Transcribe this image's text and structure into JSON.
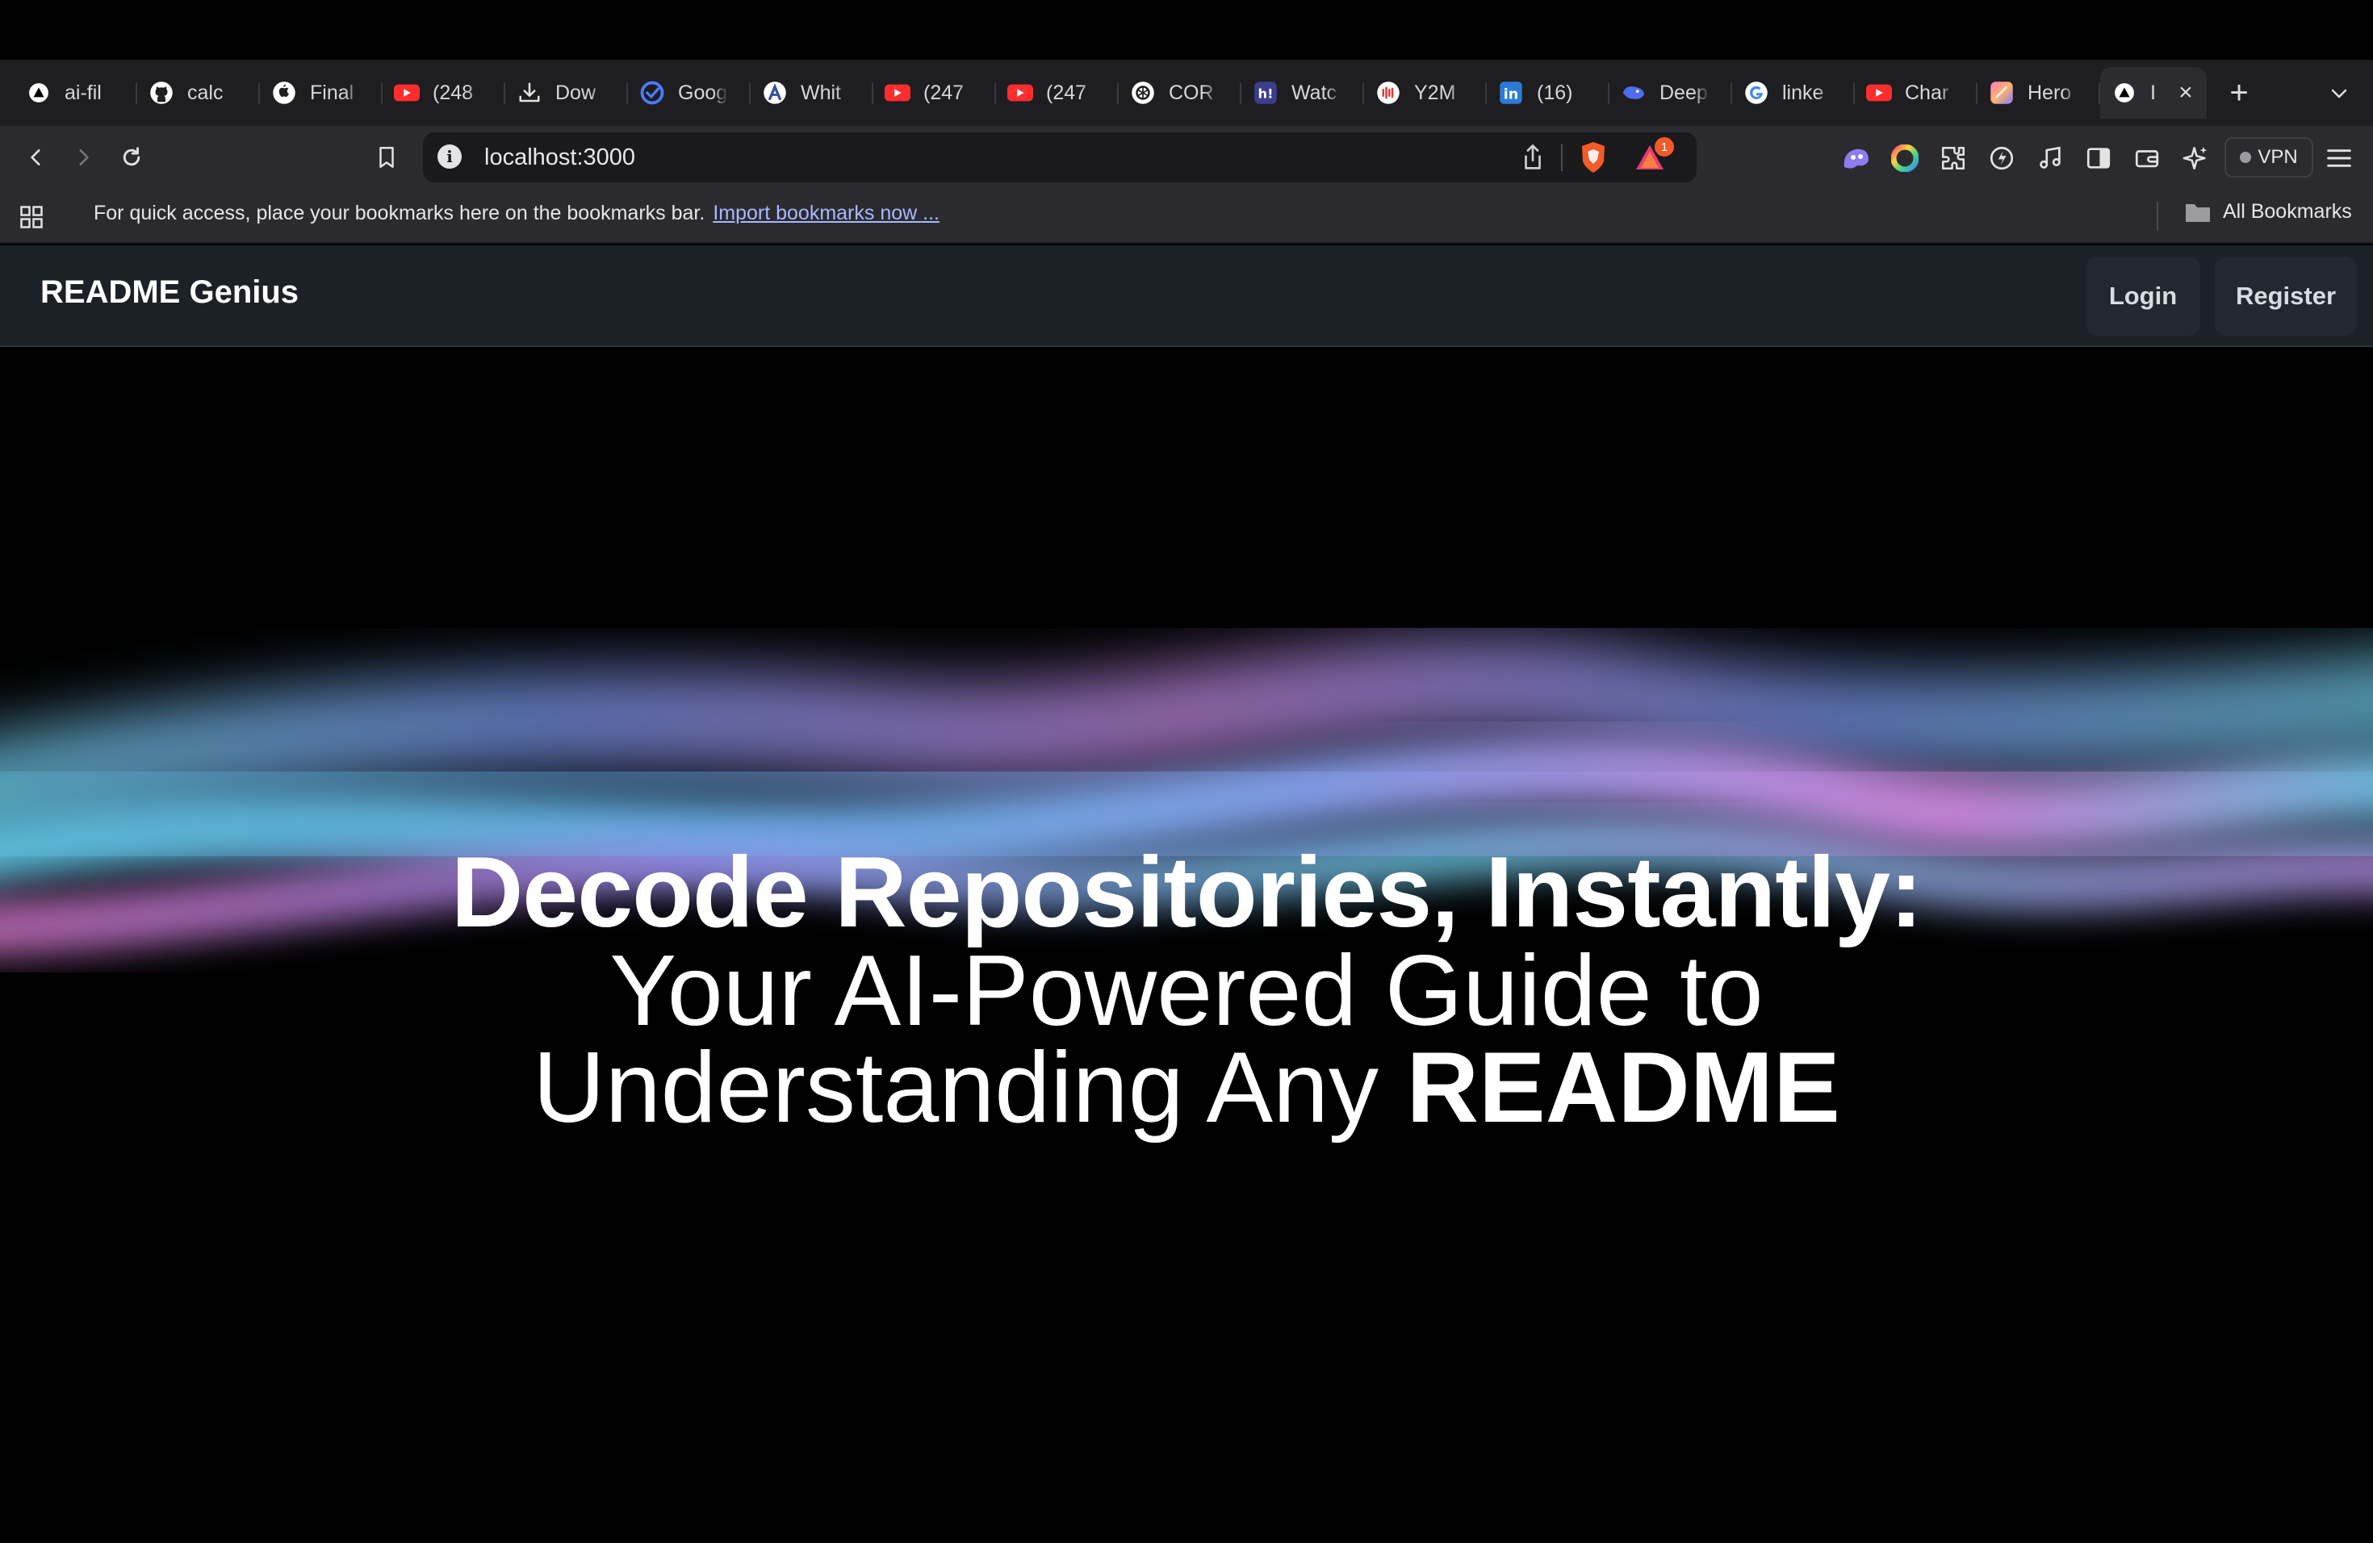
{
  "browser": {
    "tabs": [
      {
        "title": "ai-fil",
        "icon": "vercel-icon"
      },
      {
        "title": "calc",
        "icon": "github-icon"
      },
      {
        "title": "Final",
        "icon": "apple-icon"
      },
      {
        "title": "(248",
        "icon": "youtube-icon"
      },
      {
        "title": "Dow",
        "icon": "download-icon"
      },
      {
        "title": "Goog",
        "icon": "google-check-icon"
      },
      {
        "title": "Whit",
        "icon": "arc-icon"
      },
      {
        "title": "(247",
        "icon": "youtube-icon"
      },
      {
        "title": "(247",
        "icon": "youtube-icon"
      },
      {
        "title": "COR",
        "icon": "openai-icon"
      },
      {
        "title": "Watc",
        "icon": "hashnode-icon"
      },
      {
        "title": "Y2M",
        "icon": "y2mate-icon"
      },
      {
        "title": "(16)",
        "icon": "linkedin-icon"
      },
      {
        "title": "Deep",
        "icon": "deepseek-icon"
      },
      {
        "title": "linke",
        "icon": "google-icon"
      },
      {
        "title": "Char",
        "icon": "youtube-icon"
      },
      {
        "title": "Hero",
        "icon": "gradient-icon"
      },
      {
        "title": "I",
        "icon": "vercel-icon",
        "active": true
      }
    ],
    "url": "localhost:3000",
    "shield_badge": "1",
    "vpn_label": "VPN",
    "bookmarks_message": "For quick access, place your bookmarks here on the bookmarks bar.",
    "bookmarks_link": "Import bookmarks now ...",
    "all_bookmarks": "All Bookmarks"
  },
  "site": {
    "brand": "README Genius",
    "login": "Login",
    "register": "Register"
  },
  "hero": {
    "line1": "Decode Repositories, Instantly:",
    "line2": "Your AI-Powered Guide to",
    "line3_prefix": "Understanding Any ",
    "line3_bold": "README"
  },
  "colors": {
    "wave_cyan": "#6fd0e8",
    "wave_blue": "#7f9bf2",
    "wave_purple": "#c58ae6",
    "nav_bg": "#1c2128"
  }
}
